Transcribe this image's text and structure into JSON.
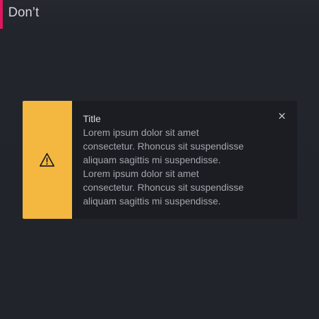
{
  "header": {
    "title": "Don’t",
    "accent_color": "#e0175f"
  },
  "notification": {
    "severity": "warning",
    "icon": "warning-triangle-icon",
    "accent_color": "#f4b740",
    "title": "Title",
    "body_lines": [
      "Lorem ipsum dolor sit amet",
      "consectetur. Rhoncus sit suspendisse",
      "aliquam sagittis mi suspendisse.",
      "Lorem ipsum dolor sit amet",
      "consectetur. Rhoncus sit suspendisse",
      "aliquam sagittis mi suspendisse."
    ],
    "close_icon": "close-icon"
  }
}
